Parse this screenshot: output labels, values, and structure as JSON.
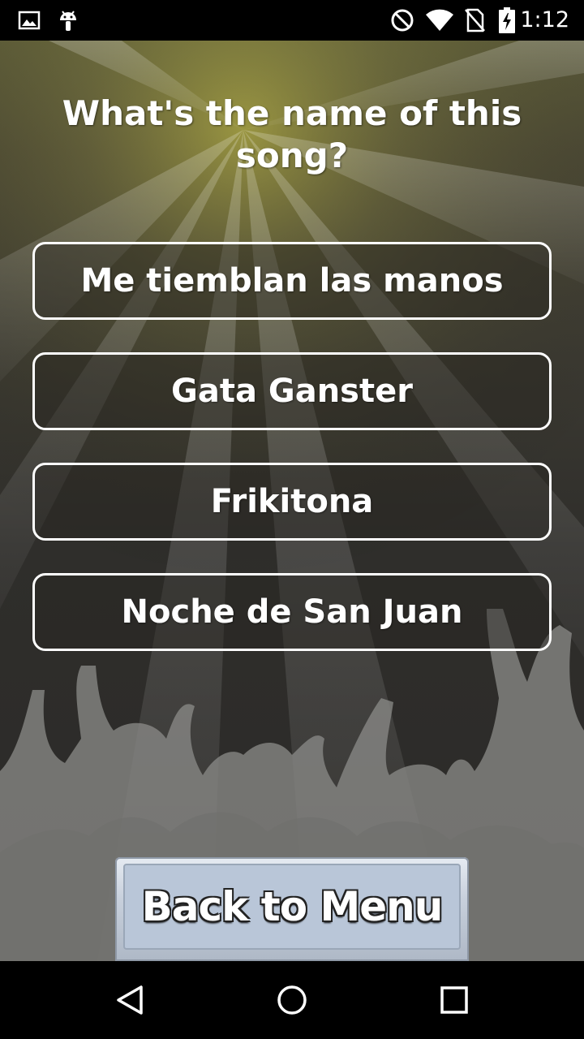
{
  "status_bar": {
    "time": "1:12",
    "icons": [
      "image-notification-icon",
      "android-debug-icon",
      "do-not-disturb-icon",
      "wifi-icon",
      "no-sim-icon",
      "battery-charging-icon"
    ]
  },
  "quiz": {
    "question": "What's the name of this song?",
    "answers": [
      {
        "label": "Me tiemblan las manos"
      },
      {
        "label": "Gata Ganster"
      },
      {
        "label": "Frikitona"
      },
      {
        "label": "Noche de San Juan"
      }
    ],
    "back_label": "Back to Menu"
  },
  "nav_bar": {
    "icons": [
      "back-nav-icon",
      "home-nav-icon",
      "recents-nav-icon"
    ]
  },
  "colors": {
    "answer_border": "#ffffff",
    "back_button_face": "#b9c6d8",
    "background_top": "#5b5a3a",
    "background_bottom": "#2b2a28"
  }
}
